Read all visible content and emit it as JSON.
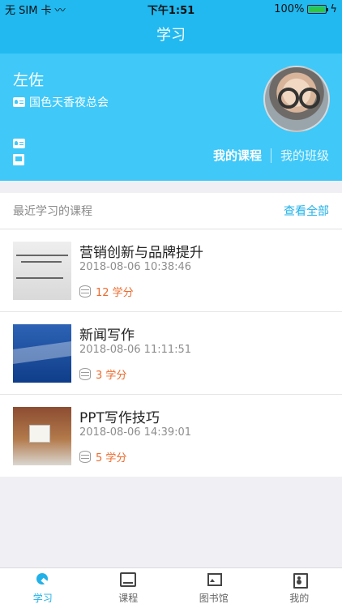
{
  "status_bar": {
    "carrier": "无 SIM 卡",
    "time": "下午1:51",
    "battery": "100%"
  },
  "header": {
    "title": "学习"
  },
  "profile": {
    "name": "左佐",
    "org": "国色天香夜总会",
    "tabs": [
      "我的课程",
      "我的班级"
    ]
  },
  "recent": {
    "title": "最近学习的课程",
    "view_all": "查看全部",
    "items": [
      {
        "title": "营销创新与品牌提升",
        "time": "2018-08-06 10:38:46",
        "credits": "12 学分"
      },
      {
        "title": "新闻写作",
        "time": "2018-08-06 11:11:51",
        "credits": "3 学分"
      },
      {
        "title": "PPT写作技巧",
        "time": "2018-08-06 14:39:01",
        "credits": "5 学分"
      }
    ]
  },
  "tabbar": {
    "items": [
      "学习",
      "课程",
      "图书馆",
      "我的"
    ]
  },
  "colors": {
    "primary": "#21b9f0",
    "profile_bg": "#3fc8f8",
    "accent": "#21b1e8",
    "credit": "#ec6b2d"
  }
}
